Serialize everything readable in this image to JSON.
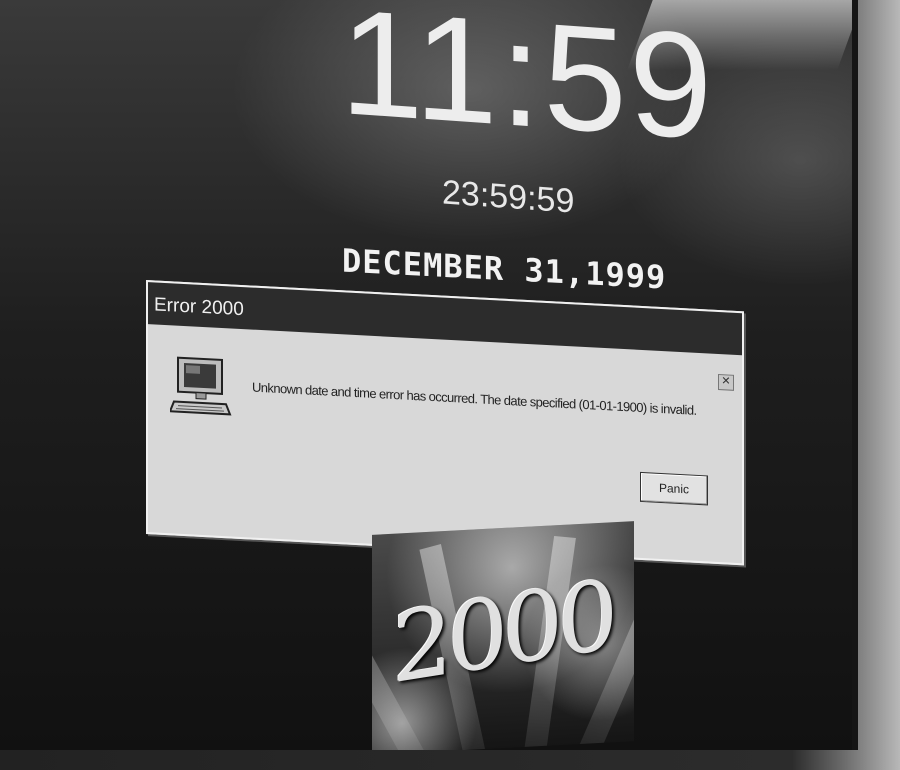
{
  "clock": {
    "time_large": "11:59",
    "time_seconds": "23:59:59"
  },
  "date_label": "DECEMBER 31,1999",
  "dialog": {
    "title": "Error 2000",
    "message": "Unknown date and time error has occurred. The date specified (01-01-1900) is invalid.",
    "button_label": "Panic",
    "icon": "computer-icon",
    "close_icon": "close-icon"
  },
  "banner": {
    "year": "2000"
  }
}
